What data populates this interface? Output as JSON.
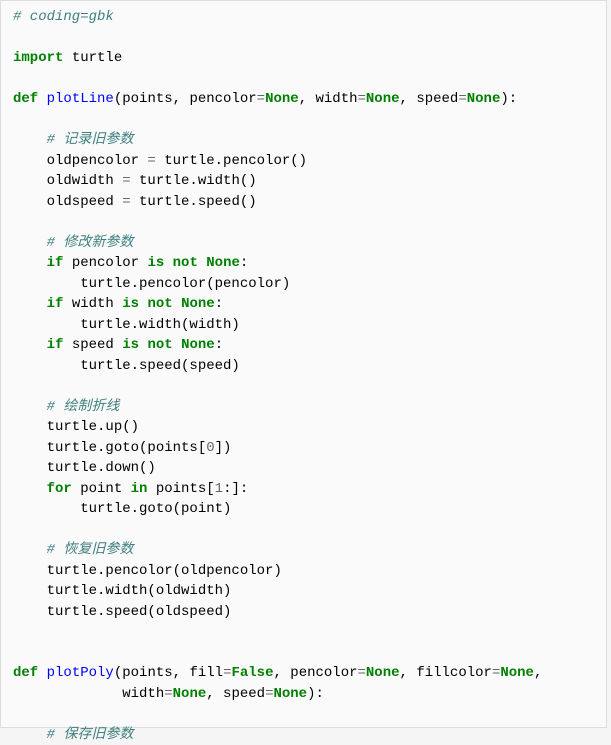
{
  "code": {
    "c1": "# coding=gbk",
    "kw_import": "import",
    "import_mod": " turtle",
    "kw_def1": "def",
    "fn1": " plotLine",
    "sig1a": "(points, pencolor",
    "eq": "=",
    "none": "None",
    "sig1b": ", width",
    "sig1c": ", speed",
    "sig1end": "):",
    "c2": "# 记录旧参数",
    "l1a": "    oldpencolor ",
    "l1b": " turtle.pencolor()",
    "l2a": "    oldwidth ",
    "l2b": " turtle.width()",
    "l3a": "    oldspeed ",
    "l3b": " turtle.speed()",
    "c3": "# 修改新参数",
    "kw_if": "if",
    "l4a": " pencolor ",
    "kw_isnot": "is",
    "kw_not": "not",
    "colon": ":",
    "l4b": "        turtle.pencolor(pencolor)",
    "l5a": " width ",
    "l5b": "        turtle.width(width)",
    "l6a": " speed ",
    "l6b": "        turtle.speed(speed)",
    "c4": "# 绘制折线",
    "l7": "    turtle.up()",
    "l8a": "    turtle.goto(points[",
    "num0": "0",
    "l8b": "])",
    "l9": "    turtle.down()",
    "kw_for": "for",
    "l10a": " point ",
    "kw_in": "in",
    "l10b": " points[",
    "num1": "1",
    "l10c": ":]:",
    "l11": "        turtle.goto(point)",
    "c5": "# 恢复旧参数",
    "l12": "    turtle.pencolor(oldpencolor)",
    "l13": "    turtle.width(oldwidth)",
    "l14": "    turtle.speed(oldspeed)",
    "kw_def2": "def",
    "fn2": " plotPoly",
    "sig2a": "(points, fill",
    "false": "False",
    "sig2b": ", pencolor",
    "sig2c": ", fillcolor",
    "sig2d": ",",
    "sig2pad": "             width",
    "sig2e": ", speed",
    "c6": "# 保存旧参数"
  }
}
